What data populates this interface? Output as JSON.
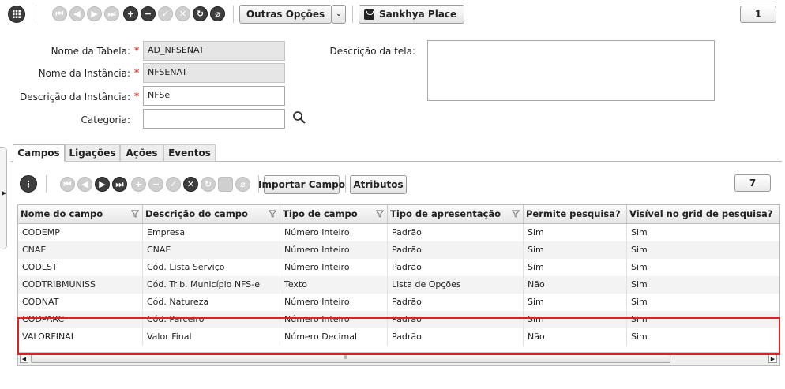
{
  "toolbar": {
    "menu_icon": "grid-menu-icon",
    "outras_opcoes_label": "Outras Opções",
    "sankhya_place_label": "Sankhya Place",
    "counter": "1"
  },
  "form": {
    "nome_tabela_label": "Nome da Tabela:",
    "nome_tabela_value": "AD_NFSENAT",
    "nome_instancia_label": "Nome da Instância:",
    "nome_instancia_value": "NFSENAT",
    "descricao_instancia_label": "Descrição da Instância:",
    "descricao_instancia_value": "NFSe",
    "categoria_label": "Categoria:",
    "categoria_value": "",
    "descricao_tela_label": "Descrição da tela:",
    "descricao_tela_value": "",
    "required_mark": "*"
  },
  "tabs": [
    "Campos",
    "Ligações",
    "Ações",
    "Eventos"
  ],
  "grid_toolbar": {
    "importar_campo_label": "Importar Campo",
    "atributos_label": "Atributos",
    "counter": "7"
  },
  "grid": {
    "columns": [
      "Nome do campo",
      "Descrição do campo",
      "Tipo de campo",
      "Tipo de apresentação",
      "Permite pesquisa?",
      "Visível no grid de pesquisa?"
    ],
    "rows": [
      [
        "CODEMP",
        "Empresa",
        "Número Inteiro",
        "Padrão",
        "Sim",
        "Sim"
      ],
      [
        "CNAE",
        "CNAE",
        "Número Inteiro",
        "Padrão",
        "Sim",
        "Sim"
      ],
      [
        "CODLST",
        "Cód. Lista Serviço",
        "Número Inteiro",
        "Padrão",
        "Sim",
        "Sim"
      ],
      [
        "CODTRIBMUNISS",
        "Cód. Trib. Município NFS-e",
        "Texto",
        "Lista de Opções",
        "Não",
        "Sim"
      ],
      [
        "CODNAT",
        "Cód. Natureza",
        "Número Inteiro",
        "Padrão",
        "Sim",
        "Sim"
      ],
      [
        "CODPARC",
        "Cód. Parceiro",
        "Número Inteiro",
        "Padrão",
        "Sim",
        "Sim"
      ],
      [
        "VALORFINAL",
        "Valor Final",
        "Número Decimal",
        "Padrão",
        "Não",
        "Sim"
      ]
    ],
    "scroll_grip": "IIII"
  },
  "colors": {
    "highlight_border": "#e02020",
    "required_star": "#e23a3a"
  }
}
